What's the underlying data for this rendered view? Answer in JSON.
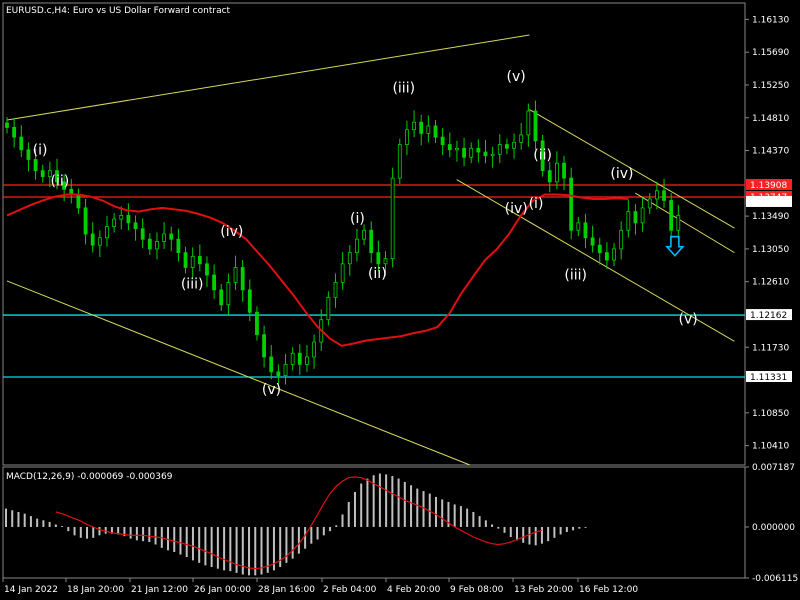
{
  "chart_data": [
    {
      "type": "candlestick",
      "title": "EURUSD.c,H4:  Euro vs US Dollar Forward contract",
      "colors": {
        "background": "#000000",
        "grid": "#555555",
        "candle": "#00d000",
        "ma": "#e01010",
        "trend": "#d8d860",
        "text": "#ffffff",
        "cyan": "#00e0e0",
        "red_level": "#ff2020"
      },
      "ylim": [
        1.1015,
        1.1635
      ],
      "yticks": [
        "1.16130",
        "1.15690",
        "1.15250",
        "1.14810",
        "1.14370",
        "1.13490",
        "1.13050",
        "1.12610",
        "1.11730",
        "1.10850",
        "1.10410"
      ],
      "xticks": [
        "14 Jan 2022",
        "18 Jan 20:00",
        "21 Jan 12:00",
        "26 Jan 00:00",
        "28 Jan 16:00",
        "2 Feb 04:00",
        "4 Feb 20:00",
        "9 Feb 08:00",
        "13 Feb 20:00",
        "16 Feb 12:00"
      ],
      "price_levels": [
        {
          "value": 1.13908,
          "label": "1.13908",
          "color": "#ff2020",
          "tag_bg": "#ff2020"
        },
        {
          "value": 1.13747,
          "label": "1.13747",
          "color": "#ff2020",
          "tag_bg": "#ff2020"
        },
        {
          "value": 1.12162,
          "label": "1.12162",
          "color": "#00e0e0",
          "tag_bg": "#ffffff"
        },
        {
          "value": 1.11331,
          "label": "1.11331",
          "color": "#00e0e0",
          "tag_bg": "#ffffff"
        }
      ],
      "current_price": {
        "value": 1.1368,
        "label": ""
      },
      "closes": [
        1.1468,
        1.1455,
        1.1438,
        1.1425,
        1.141,
        1.1402,
        1.141,
        1.1395,
        1.1385,
        1.1378,
        1.136,
        1.1325,
        1.131,
        1.132,
        1.1335,
        1.1345,
        1.135,
        1.134,
        1.1332,
        1.1318,
        1.1305,
        1.1315,
        1.1325,
        1.1318,
        1.13,
        1.128,
        1.1295,
        1.1285,
        1.127,
        1.125,
        1.123,
        1.126,
        1.128,
        1.125,
        1.122,
        1.119,
        1.116,
        1.114,
        1.1135,
        1.115,
        1.1165,
        1.115,
        1.116,
        1.118,
        1.121,
        1.124,
        1.126,
        1.1285,
        1.13,
        1.1318,
        1.133,
        1.13,
        1.1285,
        1.1292,
        1.14,
        1.1445,
        1.1465,
        1.1475,
        1.146,
        1.147,
        1.1455,
        1.1445,
        1.1438,
        1.144,
        1.1428,
        1.144,
        1.1435,
        1.143,
        1.1432,
        1.1445,
        1.144,
        1.1448,
        1.1458,
        1.149,
        1.145,
        1.141,
        1.1395,
        1.142,
        1.14,
        1.133,
        1.134,
        1.132,
        1.131,
        1.13,
        1.129,
        1.1305,
        1.133,
        1.1355,
        1.134,
        1.136,
        1.1372,
        1.1383,
        1.137,
        1.133,
        1.135
      ],
      "ma": [
        1.135,
        1.1357,
        1.1364,
        1.137,
        1.1375,
        1.1378,
        1.1378,
        1.1375,
        1.137,
        1.1362,
        1.1357,
        1.1355,
        1.1358,
        1.136,
        1.1358,
        1.1356,
        1.1352,
        1.1347,
        1.134,
        1.133,
        1.1318,
        1.13,
        1.1282,
        1.1262,
        1.1242,
        1.122,
        1.12,
        1.1185,
        1.1175,
        1.1178,
        1.1182,
        1.1184,
        1.1186,
        1.1188,
        1.1192,
        1.1195,
        1.12,
        1.1218,
        1.1245,
        1.1268,
        1.129,
        1.1305,
        1.1325,
        1.135,
        1.137,
        1.1378,
        1.1378,
        1.1377,
        1.1374,
        1.1372,
        1.1372,
        1.1373,
        1.1372
      ],
      "ma_start_index": 0,
      "ma_span_to_index": 94,
      "wave_labels": [
        {
          "text": "(i)",
          "index": 5,
          "price": 1.1432
        },
        {
          "text": "(ii)",
          "index": 8,
          "price": 1.139
        },
        {
          "text": "(iii)",
          "index": 28,
          "price": 1.1252
        },
        {
          "text": "(iv)",
          "index": 34,
          "price": 1.1322
        },
        {
          "text": "(v)",
          "index": 40,
          "price": 1.111
        },
        {
          "text": "(i)",
          "index": 53,
          "price": 1.134
        },
        {
          "text": "(ii)",
          "index": 56,
          "price": 1.1266
        },
        {
          "text": "(iii)",
          "index": 60,
          "price": 1.1515
        },
        {
          "text": "(v)",
          "index": 77,
          "price": 1.153
        },
        {
          "text": "(ii)",
          "index": 81,
          "price": 1.1425
        },
        {
          "text": "(iv)",
          "index": 77,
          "price": 1.1353
        },
        {
          "text": "(i)",
          "index": 80,
          "price": 1.136
        },
        {
          "text": "(iii)",
          "index": 86,
          "price": 1.1264
        },
        {
          "text": "(iv)",
          "index": 93,
          "price": 1.14
        },
        {
          "text": "(v)",
          "index": 103,
          "price": 1.1205
        }
      ],
      "trendlines": [
        {
          "p1": [
            0,
            1.1478
          ],
          "p2": [
            79,
            1.1592
          ]
        },
        {
          "p1": [
            0,
            1.1262
          ],
          "p2": [
            70,
            1.1015
          ]
        },
        {
          "p1": [
            79,
            1.1492
          ],
          "p2": [
            110,
            1.1333
          ]
        },
        {
          "p1": [
            68,
            1.1398
          ],
          "p2": [
            110,
            1.1181
          ]
        },
        {
          "p1": [
            95,
            1.138
          ],
          "p2": [
            110,
            1.13
          ]
        }
      ],
      "arrow": {
        "index": 101,
        "price": 1.1308,
        "color": "#00b8ff"
      }
    },
    {
      "type": "histogram",
      "title": "MACD(12,26,9) -0.000069 -0.000369",
      "ylim": [
        -0.006115,
        0.007187
      ],
      "yticks": [
        "0.007187",
        "0.000000",
        "-0.006115"
      ],
      "histogram": [
        0.0022,
        0.002,
        0.0018,
        0.0016,
        0.0013,
        0.001,
        0.0008,
        0.0006,
        0.0003,
        0.0001,
        -0.0005,
        -0.001,
        -0.0013,
        -0.0014,
        -0.0013,
        -0.001,
        -0.0008,
        -0.0008,
        -0.0009,
        -0.0011,
        -0.0014,
        -0.0016,
        -0.0017,
        -0.0018,
        -0.0021,
        -0.0025,
        -0.0028,
        -0.003,
        -0.0033,
        -0.0036,
        -0.004,
        -0.0043,
        -0.0046,
        -0.0048,
        -0.005,
        -0.0052,
        -0.0053,
        -0.0055,
        -0.0057,
        -0.0058,
        -0.0058,
        -0.0057,
        -0.0055,
        -0.0052,
        -0.0048,
        -0.0043,
        -0.0038,
        -0.0032,
        -0.0026,
        -0.002,
        -0.0015,
        -0.001,
        -0.0005,
        0.0002,
        0.0015,
        0.003,
        0.0042,
        0.0052,
        0.0058,
        0.0062,
        0.0064,
        0.0063,
        0.0061,
        0.0058,
        0.0054,
        0.005,
        0.0046,
        0.0043,
        0.004,
        0.0036,
        0.0033,
        0.003,
        0.0027,
        0.0025,
        0.0022,
        0.0018,
        0.0013,
        0.0008,
        0.0003,
        -0.0002,
        -0.0007,
        -0.0012,
        -0.0016,
        -0.0019,
        -0.0021,
        -0.0022,
        -0.002,
        -0.0017,
        -0.0013,
        -0.0009,
        -0.0006,
        -0.0004,
        -0.0002,
        -0.0001,
        0.0
      ],
      "signal": [
        0.0018,
        0.0016,
        0.0013,
        0.001,
        0.0007,
        0.0003,
        0.0,
        -0.0003,
        -0.0005,
        -0.0007,
        -0.0008,
        -0.0009,
        -0.001,
        -0.001,
        -0.001,
        -0.0011,
        -0.0012,
        -0.0013,
        -0.0015,
        -0.0017,
        -0.0019,
        -0.0021,
        -0.0023,
        -0.0026,
        -0.0029,
        -0.0032,
        -0.0036,
        -0.0039,
        -0.0042,
        -0.0045,
        -0.0047,
        -0.0049,
        -0.005,
        -0.0049,
        -0.0047,
        -0.0044,
        -0.004,
        -0.0035,
        -0.0028,
        -0.002,
        -0.001,
        0.0002,
        0.0015,
        0.0028,
        0.004,
        0.0049,
        0.0055,
        0.0059,
        0.006,
        0.0059,
        0.0056,
        0.0052,
        0.0048,
        0.0044,
        0.004,
        0.0036,
        0.0032,
        0.0029,
        0.0026,
        0.0023,
        0.0019,
        0.0015,
        0.001,
        0.0005,
        0.0,
        -0.0004,
        -0.0008,
        -0.0012,
        -0.0015,
        -0.0018,
        -0.002,
        -0.0021,
        -0.002,
        -0.0018,
        -0.0015,
        -0.0012,
        -0.0009,
        -0.0006,
        -0.0004
      ],
      "signal_start_index": 8
    }
  ]
}
